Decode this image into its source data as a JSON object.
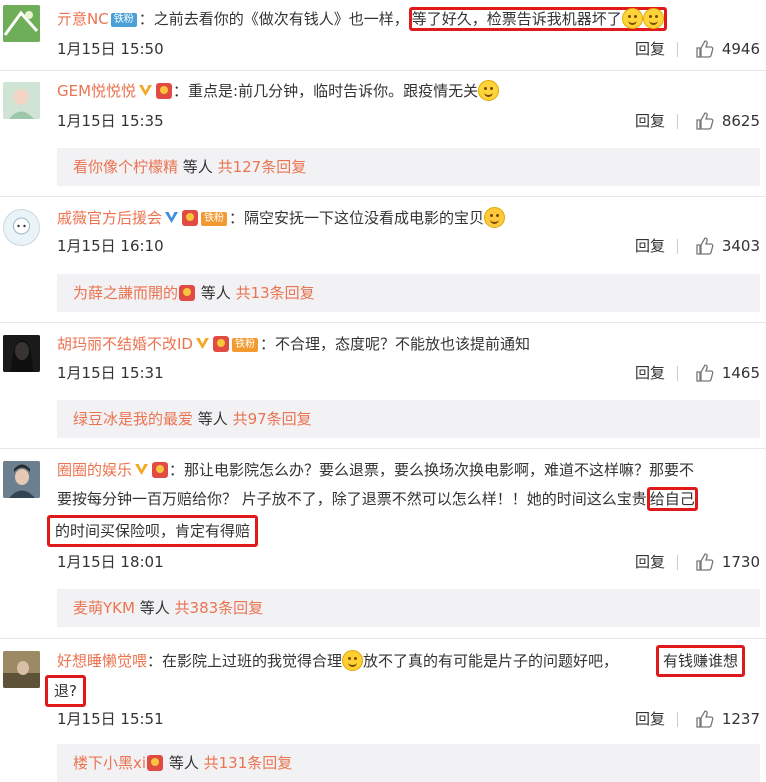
{
  "ui": {
    "reply_label": "回复",
    "deng_ren": "等人"
  },
  "comments": [
    {
      "user": "亓意NC",
      "badge": "铁粉",
      "text_a": "：之前去看你的《做次有钱人》也一样，",
      "text_hl": "等了好久，检票告诉我机器坏了",
      "time": "1月15日 15:50",
      "likes": "4946"
    },
    {
      "user": "GEM悦悦悦",
      "text_a": "：重点是:前几分钟，临时告诉你。跟疫情无关",
      "time": "1月15日 15:35",
      "likes": "8625",
      "replies_user": "看你像个柠檬精",
      "replies_count": "共127条回复"
    },
    {
      "user": "戚薇官方后援会",
      "badge": "铁粉",
      "text_a": "：隔空安抚一下这位没看成电影的宝贝",
      "time": "1月15日 16:10",
      "likes": "3403",
      "replies_user": "为薛之謙而開的",
      "replies_count": "共13条回复"
    },
    {
      "user": "胡玛丽不结婚不改ID",
      "badge": "铁粉",
      "text_a": "：不合理，态度呢？不能放也该提前通知",
      "time": "1月15日 15:31",
      "likes": "1465",
      "replies_user": "绿豆冰是我的最爱",
      "replies_count": "共97条回复"
    },
    {
      "user": "圈圈的娱乐",
      "text_a": "：那让电影院怎么办？要么退票，要么换场次换电影啊，难道不这样嘛？那要不",
      "line2": "要按每分钟一百万赔给你？ 片子放不了，除了退票不然可以怎么样！！她的时间这么宝贵",
      "hl_a": "给自己",
      "hl_b": "的时间买保险呗，肯定有得赔",
      "time": "1月15日 18:01",
      "likes": "1730",
      "replies_user": "麦萌YKM",
      "replies_count": "共383条回复"
    },
    {
      "user": "好想睡懒觉喂",
      "text_a": "：在影院上过班的我觉得合理",
      "text_b": "放不了真的有可能是片子的问题好吧，",
      "hl_a": "有钱赚谁想",
      "hl_b": "退?",
      "time": "1月15日 15:51",
      "likes": "1237",
      "replies_user": "楼下小黑xi",
      "replies_count": "共131条回复"
    }
  ],
  "colors": {
    "username": "#eb7350",
    "highlight_border": "#e0191b",
    "reply_bg": "#f2f2f5",
    "verified_gold": "#f5a623",
    "verified_blue": "#3d8fe0"
  }
}
